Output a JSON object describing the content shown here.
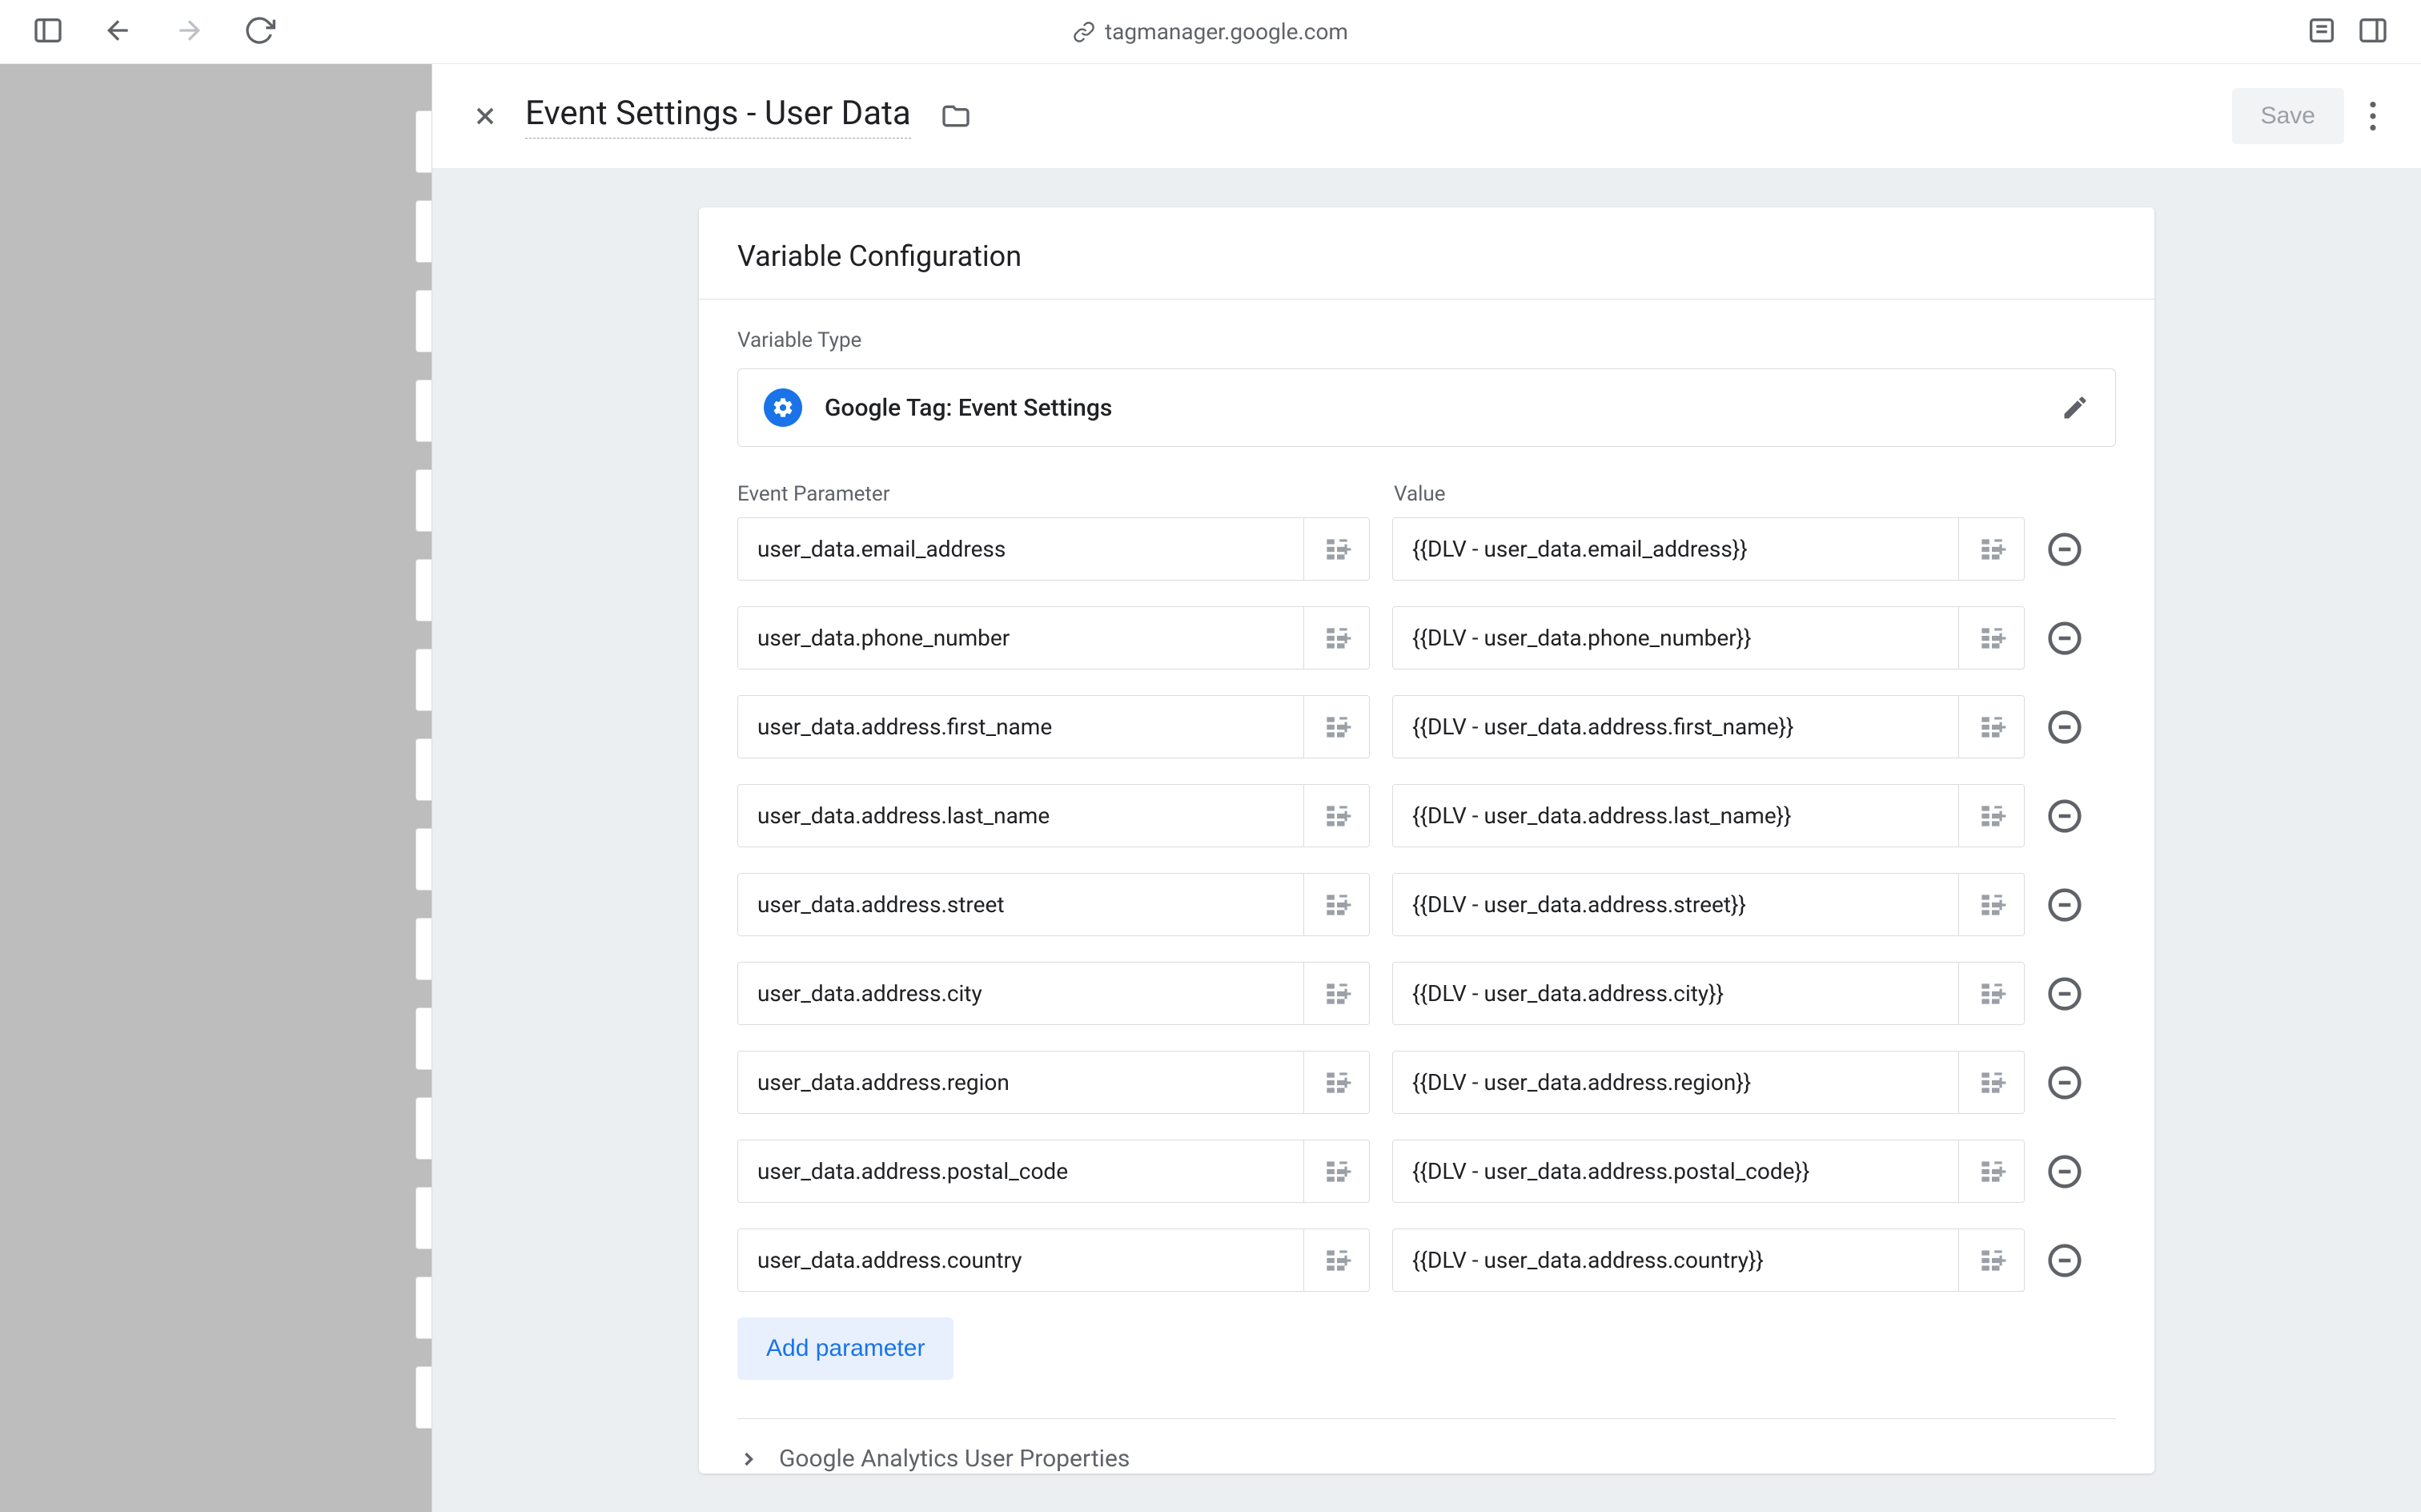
{
  "browser": {
    "url": "tagmanager.google.com"
  },
  "panel": {
    "title": "Event Settings - User Data",
    "save_label": "Save"
  },
  "card": {
    "heading": "Variable Configuration",
    "type_label": "Variable Type",
    "type_value": "Google Tag: Event Settings",
    "col_param": "Event Parameter",
    "col_value": "Value",
    "add_label": "Add parameter",
    "collapsible": "Google Analytics User Properties"
  },
  "rows": [
    {
      "param": "user_data.email_address",
      "value": "{{DLV - user_data.email_address}}"
    },
    {
      "param": "user_data.phone_number",
      "value": "{{DLV - user_data.phone_number}}"
    },
    {
      "param": "user_data.address.first_name",
      "value": "{{DLV - user_data.address.first_name}}"
    },
    {
      "param": "user_data.address.last_name",
      "value": "{{DLV - user_data.address.last_name}}"
    },
    {
      "param": "user_data.address.street",
      "value": "{{DLV - user_data.address.street}}"
    },
    {
      "param": "user_data.address.city",
      "value": "{{DLV - user_data.address.city}}"
    },
    {
      "param": "user_data.address.region",
      "value": "{{DLV - user_data.address.region}}"
    },
    {
      "param": "user_data.address.postal_code",
      "value": "{{DLV - user_data.address.postal_code}}"
    },
    {
      "param": "user_data.address.country",
      "value": "{{DLV - user_data.address.country}}"
    }
  ]
}
